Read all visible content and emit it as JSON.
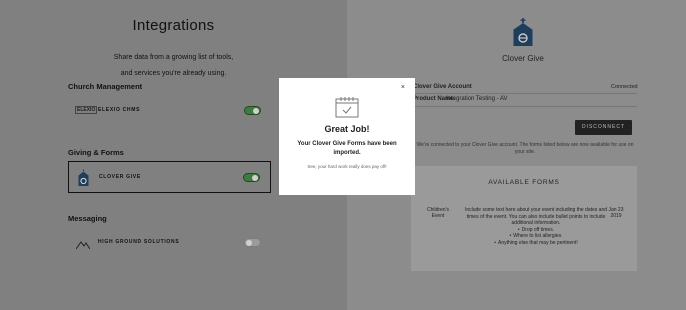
{
  "left": {
    "title": "Integrations",
    "intro_line1": "Share data from a growing list of tools,",
    "intro_line2": "and services you're already using.",
    "sections": [
      {
        "title": "Church Management",
        "items": [
          {
            "logo": "ELEXIO",
            "name": "ELEXIO CHMS",
            "enabled": true
          }
        ]
      },
      {
        "title": "Giving & Forms",
        "items": [
          {
            "name": "CLOVER GIVE",
            "enabled": true
          }
        ]
      },
      {
        "title": "Messaging",
        "items": [
          {
            "name": "HIGH GROUND SOLUTIONS",
            "enabled": false
          }
        ]
      }
    ]
  },
  "right": {
    "title": "Clover Give",
    "account_label": "Clover Give Account",
    "account_status": "Connected",
    "product_label": "Product Name:",
    "product_value": "Integration Testing - AV",
    "disconnect_label": "DISCONNECT",
    "connected_note": "We're connected to your Clover Give account. The forms listed below are now available for use on your site.",
    "forms": {
      "title": "AVAILABLE FORMS",
      "rows": [
        {
          "name": "Children's Event",
          "description": "Include some text here about your event including the dates and times of the event. You can also include bullet points to include additional information.",
          "bullets": [
            "Drop off times.",
            "Where to list allergies.",
            "Anything else that may be pertinent!"
          ],
          "date": "Jan 23 2019"
        }
      ]
    }
  },
  "modal": {
    "close_label": "×",
    "title": "Great Job!",
    "message": "Your Clover Give Forms have been imported.",
    "subtext": "See, your hard work really does pay off!"
  },
  "colors": {
    "toggle_on": "#3f7a3f",
    "toggle_off": "#9a9a9a",
    "button": "#222222",
    "accent": "#1f3d5c"
  },
  "icons": [
    "clover-give-church-icon",
    "calendar-check-icon",
    "close-icon",
    "elexio-logo",
    "clover-give-logo",
    "high-ground-logo"
  ]
}
